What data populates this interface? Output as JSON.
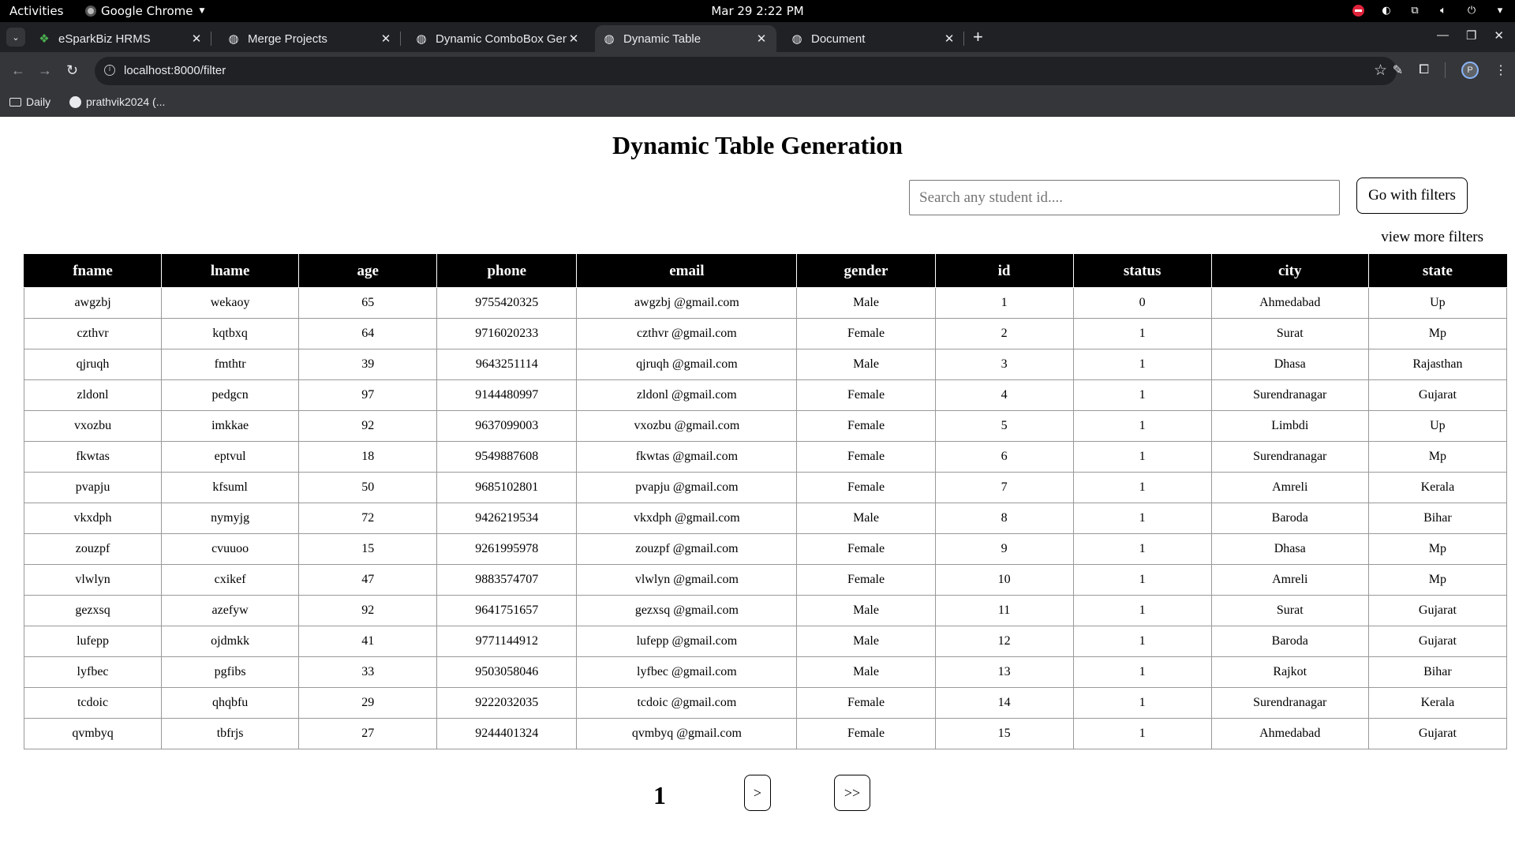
{
  "system_bar": {
    "activities": "Activities",
    "app_name": "Google Chrome",
    "clock": "Mar 29  2:22 PM"
  },
  "tabs": [
    {
      "title": "eSparkBiz HRMS",
      "icon": "esparkbiz-icon"
    },
    {
      "title": "Merge Projects",
      "icon": "globe-icon"
    },
    {
      "title": "Dynamic ComboBox Gen",
      "icon": "globe-icon"
    },
    {
      "title": "Dynamic Table",
      "icon": "globe-icon",
      "active": true
    },
    {
      "title": "Document",
      "icon": "globe-icon"
    }
  ],
  "address_bar": {
    "url": "localhost:8000/filter"
  },
  "bookmarks": [
    {
      "label": "Daily",
      "icon": "folder-icon"
    },
    {
      "label": "prathvik2024 (...",
      "icon": "github-icon"
    }
  ],
  "page": {
    "title": "Dynamic Table Generation",
    "search_placeholder": "Search any student id....",
    "go_button": "Go with filters",
    "more_filters": "view more filters"
  },
  "table": {
    "columns": [
      "fname",
      "lname",
      "age",
      "phone",
      "email",
      "gender",
      "id",
      "status",
      "city",
      "state"
    ],
    "rows": [
      [
        "awgzbj",
        "wekaoy",
        "65",
        "9755420325",
        "awgzbj @gmail.com",
        "Male",
        "1",
        "0",
        "Ahmedabad",
        "Up"
      ],
      [
        "czthvr",
        "kqtbxq",
        "64",
        "9716020233",
        "czthvr @gmail.com",
        "Female",
        "2",
        "1",
        "Surat",
        "Mp"
      ],
      [
        "qjruqh",
        "fmthtr",
        "39",
        "9643251114",
        "qjruqh @gmail.com",
        "Male",
        "3",
        "1",
        "Dhasa",
        "Rajasthan"
      ],
      [
        "zldonl",
        "pedgcn",
        "97",
        "9144480997",
        "zldonl @gmail.com",
        "Female",
        "4",
        "1",
        "Surendranagar",
        "Gujarat"
      ],
      [
        "vxozbu",
        "imkkae",
        "92",
        "9637099003",
        "vxozbu @gmail.com",
        "Female",
        "5",
        "1",
        "Limbdi",
        "Up"
      ],
      [
        "fkwtas",
        "eptvul",
        "18",
        "9549887608",
        "fkwtas @gmail.com",
        "Female",
        "6",
        "1",
        "Surendranagar",
        "Mp"
      ],
      [
        "pvapju",
        "kfsuml",
        "50",
        "9685102801",
        "pvapju @gmail.com",
        "Female",
        "7",
        "1",
        "Amreli",
        "Kerala"
      ],
      [
        "vkxdph",
        "nymyjg",
        "72",
        "9426219534",
        "vkxdph @gmail.com",
        "Male",
        "8",
        "1",
        "Baroda",
        "Bihar"
      ],
      [
        "zouzpf",
        "cvuuoo",
        "15",
        "9261995978",
        "zouzpf @gmail.com",
        "Female",
        "9",
        "1",
        "Dhasa",
        "Mp"
      ],
      [
        "vlwlyn",
        "cxikef",
        "47",
        "9883574707",
        "vlwlyn @gmail.com",
        "Female",
        "10",
        "1",
        "Amreli",
        "Mp"
      ],
      [
        "gezxsq",
        "azefyw",
        "92",
        "9641751657",
        "gezxsq @gmail.com",
        "Male",
        "11",
        "1",
        "Surat",
        "Gujarat"
      ],
      [
        "lufepp",
        "ojdmkk",
        "41",
        "9771144912",
        "lufepp @gmail.com",
        "Male",
        "12",
        "1",
        "Baroda",
        "Gujarat"
      ],
      [
        "lyfbec",
        "pgfibs",
        "33",
        "9503058046",
        "lyfbec @gmail.com",
        "Male",
        "13",
        "1",
        "Rajkot",
        "Bihar"
      ],
      [
        "tcdoic",
        "qhqbfu",
        "29",
        "9222032035",
        "tcdoic @gmail.com",
        "Female",
        "14",
        "1",
        "Surendranagar",
        "Kerala"
      ],
      [
        "qvmbyq",
        "tbfrjs",
        "27",
        "9244401324",
        "qvmbyq @gmail.com",
        "Female",
        "15",
        "1",
        "Ahmedabad",
        "Gujarat"
      ]
    ]
  },
  "pagination": {
    "current": "1",
    "next": ">",
    "last": ">>"
  }
}
